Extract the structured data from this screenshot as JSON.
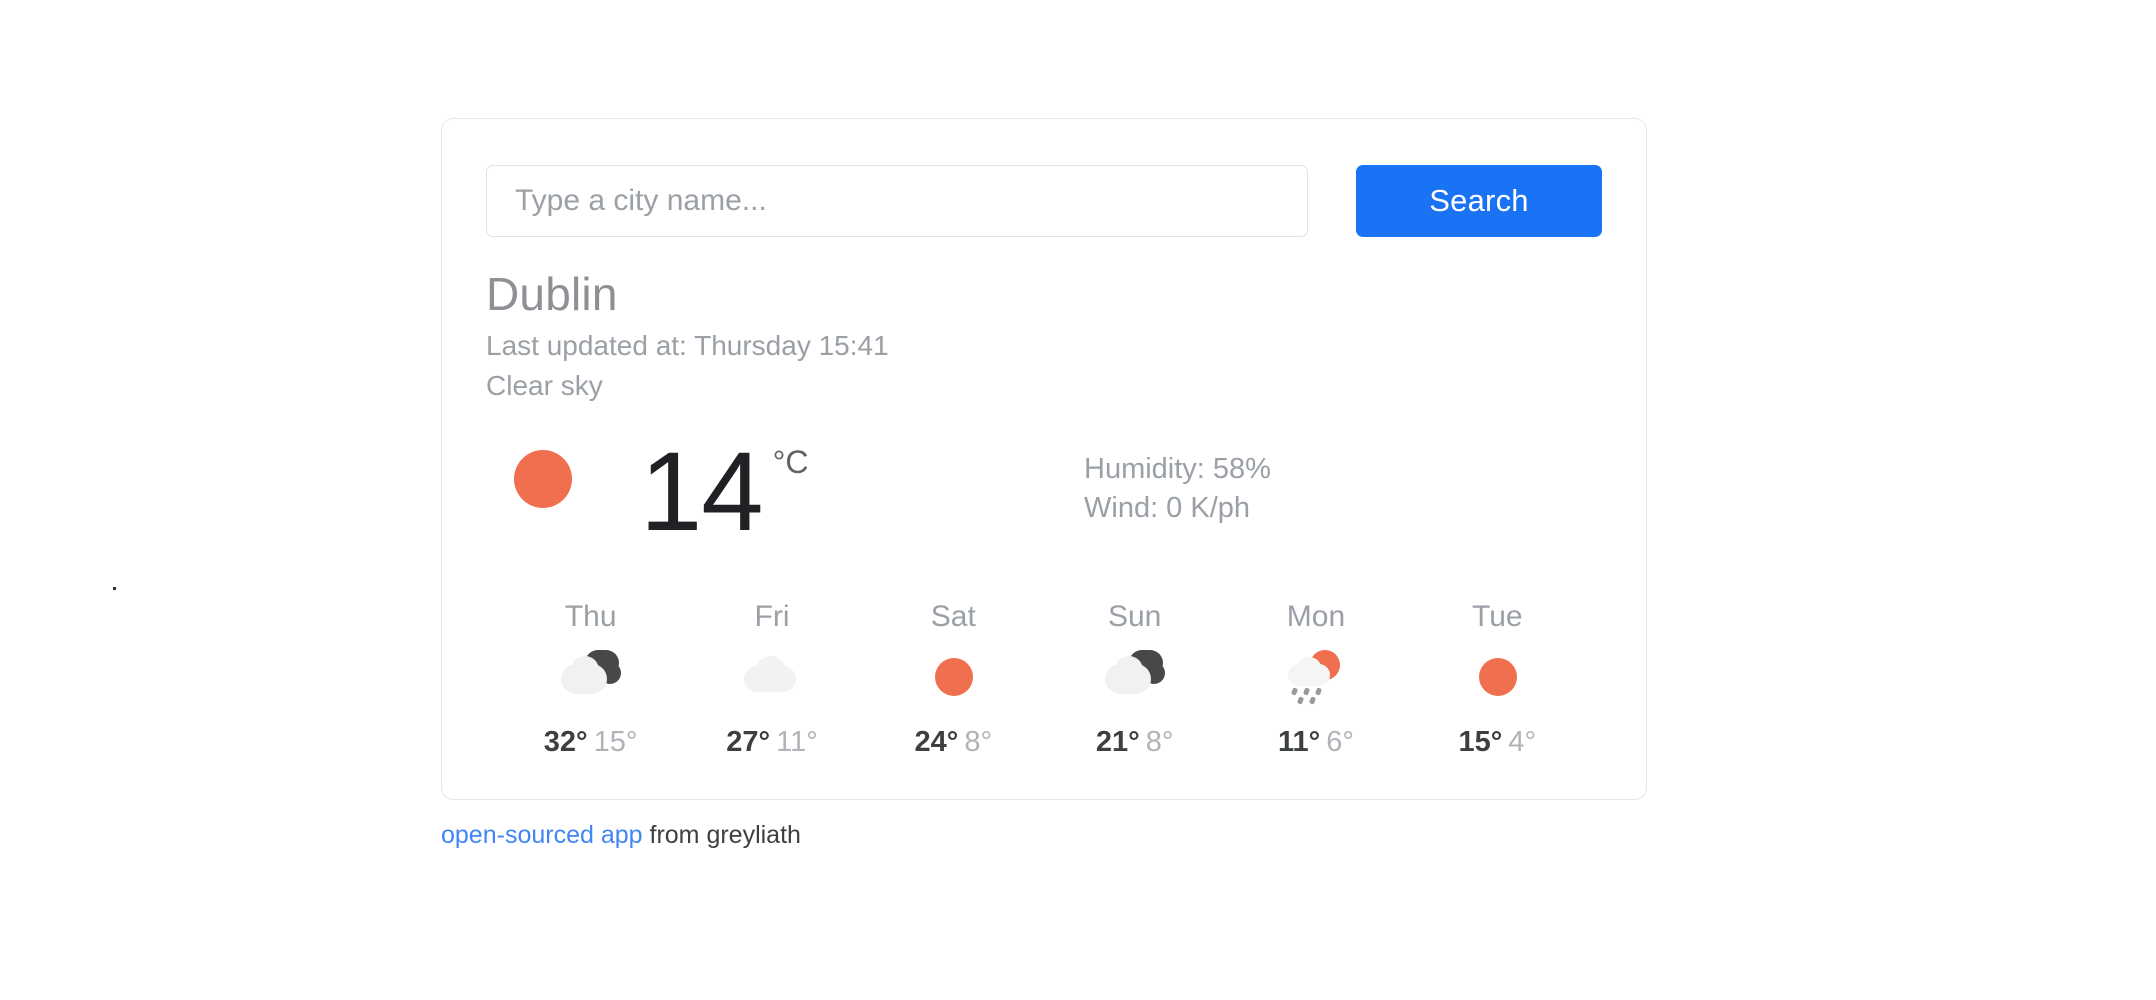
{
  "search": {
    "placeholder": "Type a city name...",
    "value": "",
    "button_label": "Search"
  },
  "location": {
    "city": "Dublin",
    "last_updated": "Last updated at: Thursday 15:41",
    "description": "Clear sky"
  },
  "current": {
    "icon": "sun-icon",
    "temperature": "14",
    "unit": "°C",
    "humidity": "Humidity: 58%",
    "wind": "Wind: 0 K/ph"
  },
  "forecast": [
    {
      "day": "Thu",
      "icon": "broken-clouds-icon",
      "high": "32°",
      "low": "15°"
    },
    {
      "day": "Fri",
      "icon": "cloud-icon",
      "high": "27°",
      "low": "11°"
    },
    {
      "day": "Sat",
      "icon": "sun-icon",
      "high": "24°",
      "low": "8°"
    },
    {
      "day": "Sun",
      "icon": "broken-clouds-icon",
      "high": "21°",
      "low": "8°"
    },
    {
      "day": "Mon",
      "icon": "sun-rain-icon",
      "high": "11°",
      "low": "6°"
    },
    {
      "day": "Tue",
      "icon": "sun-icon",
      "high": "15°",
      "low": "4°"
    }
  ],
  "footer": {
    "link_text": "open-sourced app",
    "suffix_text": " from greyliath"
  },
  "colors": {
    "accent_blue": "#1a73f5",
    "sun_orange": "#ef6f4e",
    "link_blue": "#4285f4",
    "cloud_light": "#f1f1f1",
    "cloud_dark": "#484848",
    "text_muted": "#9aa0a6",
    "text_dark": "#3c4043"
  }
}
